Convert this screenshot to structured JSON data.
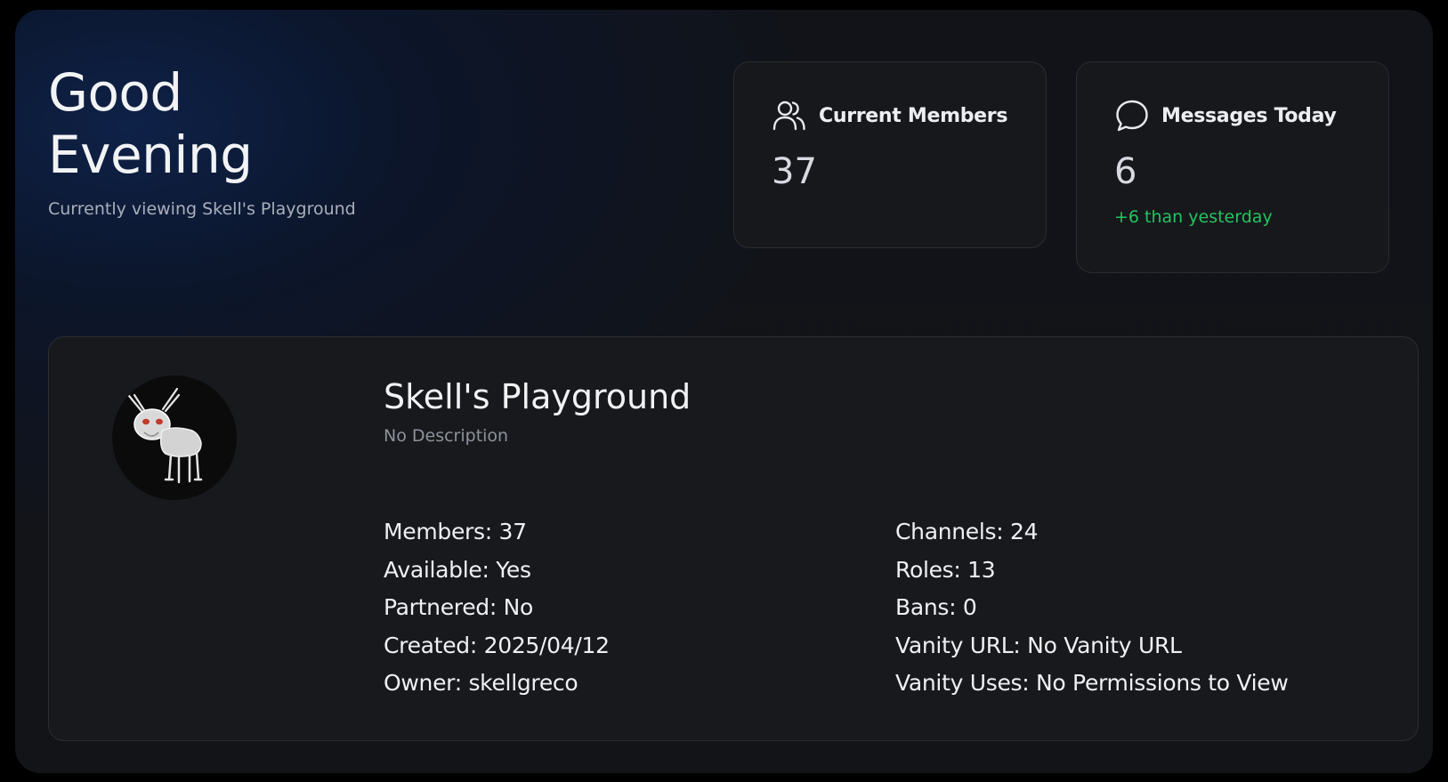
{
  "greeting": {
    "line1": "Good",
    "line2": "Evening",
    "subtitle": "Currently viewing Skell's Playground"
  },
  "stats": {
    "members": {
      "title": "Current Members",
      "icon": "users-icon",
      "value": "37"
    },
    "messages": {
      "title": "Messages Today",
      "icon": "chat-bubble-icon",
      "value": "6",
      "delta": "+6 than yesterday"
    }
  },
  "server": {
    "name": "Skell's Playground",
    "description": "No Description",
    "info_left": [
      "Members: 37",
      "Available: Yes",
      "Partnered: No",
      "Created: 2025/04/12",
      "Owner: skellgreco"
    ],
    "info_right": [
      "Channels: 24",
      "Roles: 13",
      "Bans: 0",
      "Vanity URL: No Vanity URL",
      "Vanity Uses: No Permissions to View"
    ]
  },
  "colors": {
    "background": "#131417",
    "card": "#17181c",
    "accent_green": "#22c55e",
    "text_primary": "#f2f3f5",
    "text_muted": "#8d929c"
  }
}
